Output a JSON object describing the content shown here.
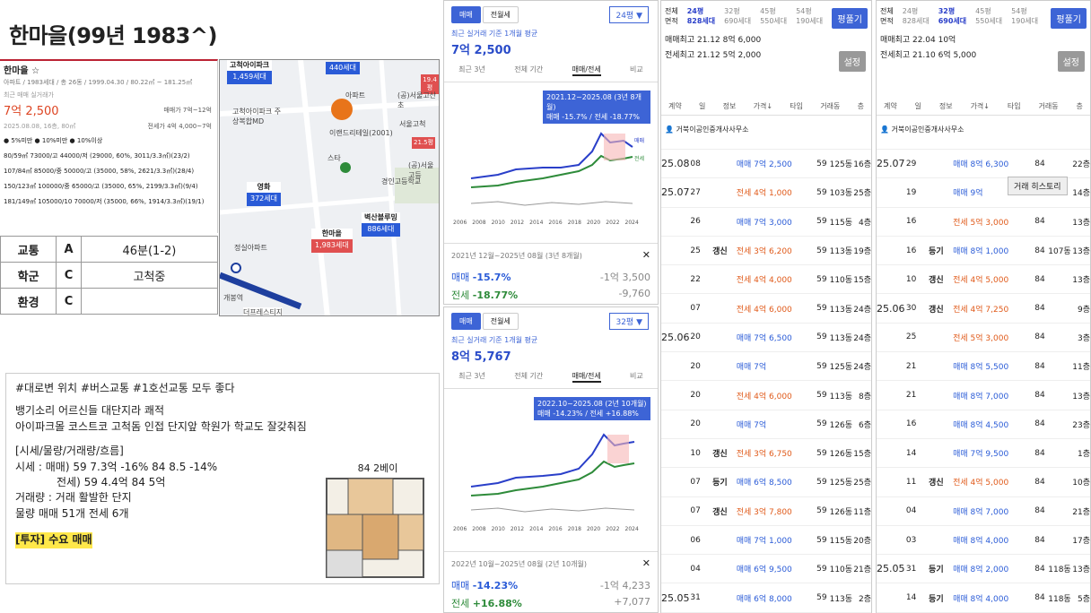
{
  "title": "한마을(99년 1983^)",
  "info": {
    "name": "한마을 ☆",
    "spec": "아파트 / 1983세대 / 총 26동 / 1999.04.30 / 80.22㎡ ~ 181.25㎡",
    "recent_label": "최근 매매 실거래가",
    "price": "7억 2,500",
    "date": "2025.08.08, 16층, 80㎡",
    "sale_label": "매매가 7억~12억",
    "jeonse_label": "전세가 4억 4,000~7억",
    "legend": "● 5%미만  ● 10%미만  ● 10%이상",
    "rows": [
      "80/59㎡  73000/고 44000/저 (29000, 60%, 3011/3.3㎡)(23/2)",
      "107/84㎡  85000/중 50000/고 (35000, 58%, 2621/3.3㎡)(28/4)",
      "150/123㎡  100000/중 65000/고 (35000, 65%, 2199/3.3㎡)(9/4)",
      "181/149㎡  105000/10 70000/저 (35000, 66%, 1914/3.3㎡)(19/1)"
    ]
  },
  "score": [
    [
      "교통",
      "A",
      "46분(1-2)"
    ],
    [
      "학군",
      "C",
      "고척중"
    ],
    [
      "환경",
      "C",
      ""
    ]
  ],
  "map": {
    "tags": [
      {
        "name": "고척아이파크",
        "count": "1,459세대"
      },
      {
        "name": "",
        "count": "440세대"
      },
      {
        "name": "영화",
        "count": "372세대"
      },
      {
        "name": "한마을",
        "count": "1,983세대"
      },
      {
        "name": "벽산블루밍",
        "count": "886세대"
      },
      {
        "name": "",
        "count": "19.4평"
      },
      {
        "name": "",
        "count": "21.5평"
      }
    ],
    "labels": [
      "고척아이파크 주상복합MD",
      "이랜드리테일(2001)",
      "(공)서울고산초",
      "서울고척",
      "(공)서울고등",
      "경인고등학교",
      "정실아파트",
      "개봉역",
      "스타",
      "아파트",
      "더프레스티지"
    ]
  },
  "note": {
    "tags": "#대로변 위치 #버스교통 #1호선교통 모두 좋다",
    "desc1": "뱅기소리 어르신들 대단지라 쾌적",
    "desc2": "아이파크몰 코스트코 고척돔 인접 단지앞 학원가 학교도 잘갖춰짐",
    "h": "[시세/물량/거래량/흐름]",
    "l1": "시세 : 매매) 59 7.3억 -16%  84 8.5 -14%",
    "l2": "전세) 59 4.4억 84 5억",
    "l3": "거래량 : 거래 활발한 단지",
    "l4": "물량 매매 51개 전세 6개",
    "invest": "[투자] 수요 매매",
    "plan_caption": "84 2베이"
  },
  "chart1": {
    "tab1": "매매",
    "tab2": "전월세",
    "size": "24평 ▼",
    "avg_label": "최근 실거래 기준 1개월 평균",
    "avg": "7억 2,500",
    "periods": [
      "최근 3년",
      "전체 기간",
      "매매/전세",
      "비교"
    ],
    "tooltip1": "2021.12~2025.08 (3년 8개월)",
    "tooltip2": "매매 -15.7% / 전세 -18.77%",
    "range": "2021년 12월~2025년 08월 (3년 8개월)",
    "sale_pct": "-15.7%",
    "sale_amt": "-1억 3,500",
    "jeonse_pct": "-18.77%",
    "jeonse_amt": "-9,760",
    "sale": "매매",
    "jeonse": "전세",
    "xticks": [
      "2006",
      "2008",
      "2010",
      "2012",
      "2014",
      "2016",
      "2018",
      "2020",
      "2022",
      "2024"
    ]
  },
  "chart2": {
    "tab1": "매매",
    "tab2": "전월세",
    "size": "32평 ▼",
    "avg_label": "최근 실거래 기준 1개월 평균",
    "avg": "8억 5,767",
    "periods": [
      "최근 3년",
      "전체 기간",
      "매매/전세",
      "비교"
    ],
    "tooltip1": "2022.10~2025.08 (2년 10개월)",
    "tooltip2": "매매 -14.23% / 전세 +16.88%",
    "range": "2022년 10월~2025년 08월 (2년 10개월)",
    "sale_pct": "-14.23%",
    "sale_amt": "-1억 4,233",
    "jeonse_pct": "+16.88%",
    "jeonse_amt": "+7,077",
    "sale": "매매",
    "jeonse": "전세",
    "xticks": [
      "2006",
      "2008",
      "2010",
      "2012",
      "2014",
      "2016",
      "2018",
      "2020",
      "2022",
      "2024"
    ]
  },
  "tx1": {
    "sizes": [
      "24평",
      "32평",
      "45평",
      "54평"
    ],
    "units": [
      "828세대",
      "690세대",
      "550세대",
      "190세대"
    ],
    "row_labels": [
      "전체",
      "면적"
    ],
    "btn": "평풀기",
    "btn2": "설정",
    "hi_sale": "매매최고 21.12 8억 6,000",
    "hi_jeonse": "전세최고 21.12 5억 2,000",
    "cols": [
      "계약",
      "일",
      "정보",
      "가격↓",
      "타입",
      "거래동",
      "층"
    ],
    "agent": "거북이공인중개사사무소",
    "rows": [
      [
        "25.08",
        "08",
        "",
        "매매 7억 2,500",
        "59",
        "125동",
        "16층"
      ],
      [
        "25.07",
        "27",
        "",
        "전세 4억 1,000",
        "59",
        "103동",
        "25층"
      ],
      [
        "",
        "26",
        "",
        "매매 7억 3,000",
        "59",
        "115동",
        "4층"
      ],
      [
        "",
        "25",
        "갱신",
        "전세 3억 6,200",
        "59",
        "113동",
        "19층"
      ],
      [
        "",
        "22",
        "",
        "전세 4억 4,000",
        "59",
        "110동",
        "15층"
      ],
      [
        "",
        "07",
        "",
        "전세 4억 6,000",
        "59",
        "113동",
        "24층"
      ],
      [
        "25.06",
        "20",
        "",
        "매매 7억 6,500",
        "59",
        "113동",
        "24층"
      ],
      [
        "",
        "20",
        "",
        "매매 7억",
        "59",
        "125동",
        "24층"
      ],
      [
        "",
        "20",
        "",
        "전세 4억 6,000",
        "59",
        "113동",
        "8층"
      ],
      [
        "",
        "20",
        "",
        "매매 7억",
        "59",
        "126동",
        "6층"
      ],
      [
        "",
        "10",
        "갱신",
        "전세 3억 6,750",
        "59",
        "126동",
        "15층"
      ],
      [
        "",
        "07",
        "등기",
        "매매 6억 8,500",
        "59",
        "125동",
        "25층"
      ],
      [
        "",
        "07",
        "갱신",
        "전세 3억 7,800",
        "59",
        "126동",
        "11층"
      ],
      [
        "",
        "06",
        "",
        "매매 7억 1,000",
        "59",
        "115동",
        "20층"
      ],
      [
        "",
        "04",
        "",
        "매매 6억 9,500",
        "59",
        "110동",
        "21층"
      ],
      [
        "25.05",
        "31",
        "",
        "매매 6억 8,000",
        "59",
        "113동",
        "2층"
      ]
    ]
  },
  "tx2": {
    "sizes": [
      "24평",
      "32평",
      "45평",
      "54평"
    ],
    "units": [
      "828세대",
      "690세대",
      "550세대",
      "190세대"
    ],
    "row_labels": [
      "전체",
      "면적"
    ],
    "btn": "평풀기",
    "btn2": "설정",
    "hi_sale": "매매최고 22.04 10억",
    "hi_jeonse": "전세최고 21.10 6억 5,000",
    "cols": [
      "계약",
      "일",
      "정보",
      "가격↓",
      "타입",
      "거래동",
      "층"
    ],
    "agent": "거북이공인중개사사무소",
    "tooltip": "거래 히스토리",
    "rows": [
      [
        "25.07",
        "29",
        "",
        "매매 8억 6,300",
        "84",
        "",
        "22층"
      ],
      [
        "",
        "19",
        "",
        "매매 9억",
        "84",
        "",
        "14층"
      ],
      [
        "",
        "16",
        "",
        "전세 5억 3,000",
        "84",
        "",
        "13층"
      ],
      [
        "",
        "16",
        "등기",
        "매매 8억 1,000",
        "84",
        "107동",
        "13층"
      ],
      [
        "",
        "10",
        "갱신",
        "전세 4억 5,000",
        "84",
        "",
        "13층"
      ],
      [
        "25.06",
        "30",
        "갱신",
        "전세 4억 7,250",
        "84",
        "",
        "9층"
      ],
      [
        "",
        "25",
        "",
        "전세 5억 3,000",
        "84",
        "",
        "3층"
      ],
      [
        "",
        "21",
        "",
        "매매 8억 5,500",
        "84",
        "",
        "11층"
      ],
      [
        "",
        "21",
        "",
        "매매 8억 7,000",
        "84",
        "",
        "13층"
      ],
      [
        "",
        "16",
        "",
        "매매 8억 4,500",
        "84",
        "",
        "23층"
      ],
      [
        "",
        "14",
        "",
        "매매 7억 9,500",
        "84",
        "",
        "1층"
      ],
      [
        "",
        "11",
        "갱신",
        "전세 4억 5,000",
        "84",
        "",
        "10층"
      ],
      [
        "",
        "04",
        "",
        "매매 8억 7,000",
        "84",
        "",
        "21층"
      ],
      [
        "",
        "03",
        "",
        "매매 8억 4,000",
        "84",
        "",
        "17층"
      ],
      [
        "25.05",
        "31",
        "등기",
        "매매 8억 2,000",
        "84",
        "118동",
        "13층"
      ],
      [
        "",
        "14",
        "등기",
        "매매 8억 4,000",
        "84",
        "118동",
        "5층"
      ]
    ]
  }
}
